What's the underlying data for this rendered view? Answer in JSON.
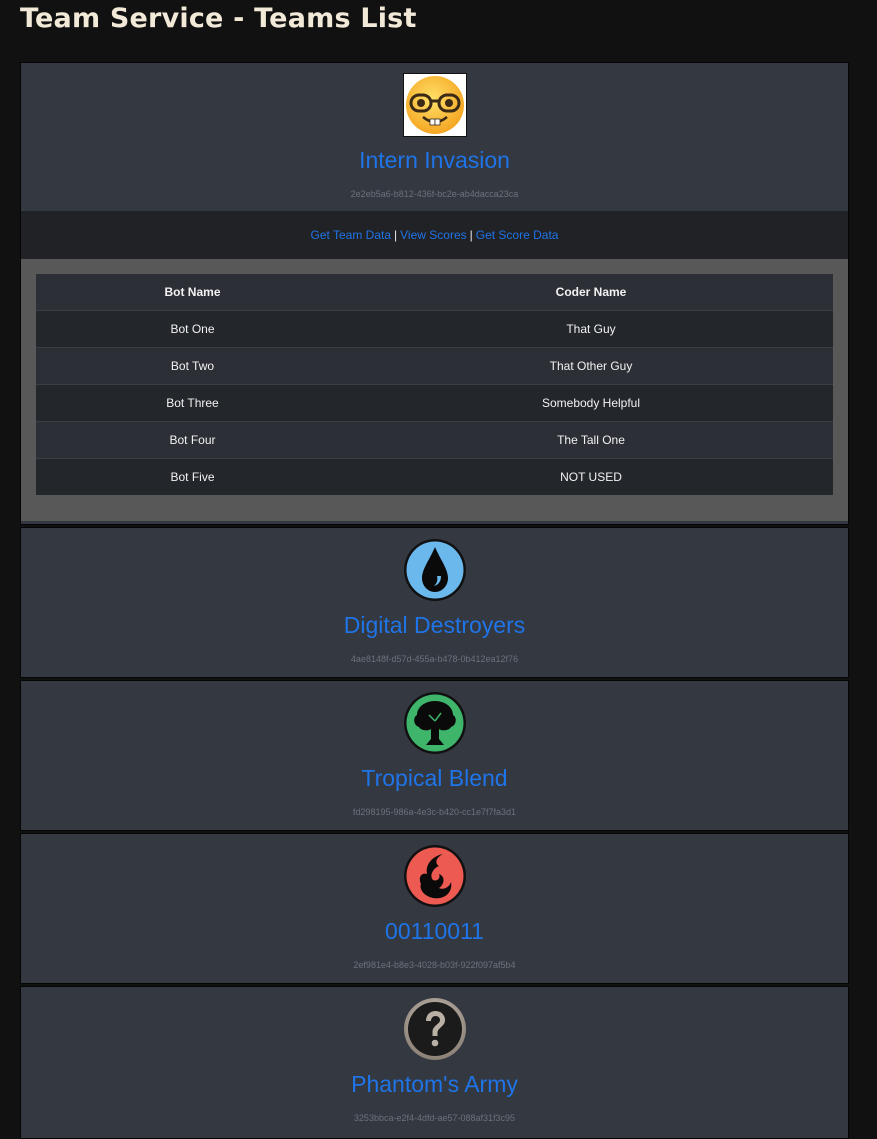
{
  "page": {
    "title": "Team Service - Teams List"
  },
  "links": {
    "get_team_data": "Get Team Data",
    "view_scores": "View Scores",
    "get_score_data": "Get Score Data",
    "separator": "|"
  },
  "teams": [
    {
      "name": "Intern Invasion",
      "id": "2e2eb5a6-b812-436f-bc2e-ab4dacca23ca",
      "icon": "nerd-face-icon",
      "expanded": true,
      "table": {
        "headers": [
          "Bot Name",
          "Coder Name"
        ],
        "rows": [
          [
            "Bot One",
            "That Guy"
          ],
          [
            "Bot Two",
            "That Other Guy"
          ],
          [
            "Bot Three",
            "Somebody Helpful"
          ],
          [
            "Bot Four",
            "The Tall One"
          ],
          [
            "Bot Five",
            "NOT USED"
          ]
        ]
      }
    },
    {
      "name": "Digital Destroyers",
      "id": "4ae8148f-d57d-455a-b478-0b412ea12f76",
      "icon": "water-drop-icon"
    },
    {
      "name": "Tropical Blend",
      "id": "fd298195-986a-4e3c-b420-cc1e7f7fa3d1",
      "icon": "tree-icon"
    },
    {
      "name": "00110011",
      "id": "2ef981e4-b8e3-4028-b03f-922f097af5b4",
      "icon": "fire-icon"
    },
    {
      "name": "Phantom's Army",
      "id": "3253bbca-e2f4-4dfd-ae57-088af31f3c95",
      "icon": "question-mark-icon"
    }
  ],
  "colors": {
    "link": "#1f74e8",
    "card": "#343841",
    "background": "#111111"
  }
}
